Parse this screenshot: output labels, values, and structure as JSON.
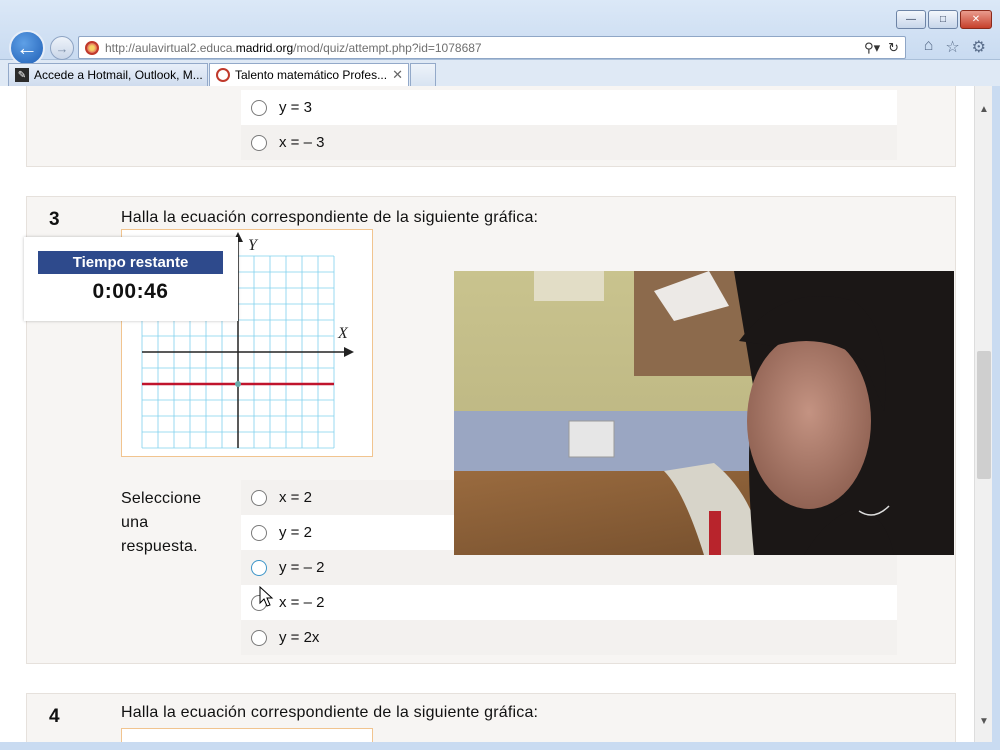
{
  "browser": {
    "url_prefix": "http://aulavirtual2.educa.",
    "url_domain": "madrid.org",
    "url_path": "/mod/quiz/attempt.php?id=1078687",
    "tabs": [
      {
        "label": "Accede a Hotmail, Outlook, M..."
      },
      {
        "label": "Talento matemático Profes..."
      }
    ]
  },
  "quiz": {
    "q2": {
      "options": [
        "y = 3",
        "x = – 3"
      ]
    },
    "q3": {
      "number": "3",
      "text": "Halla la ecuación correspondiente de la siguiente gráfica:",
      "select_label": "Seleccione una respuesta.",
      "graph_axis_x": "X",
      "graph_axis_y": "Y",
      "graph_line_value": -2,
      "options": [
        "x = 2",
        "y = 2",
        "y = – 2",
        "x = – 2",
        "y = 2x"
      ]
    },
    "q4": {
      "number": "4",
      "text": "Halla la ecuación correspondiente de la siguiente gráfica:"
    }
  },
  "timer": {
    "title": "Tiempo restante",
    "value": "0:00:46"
  },
  "colors": {
    "timer_header": "#2e4a8c",
    "graph_line": "#c0142c",
    "grid": "#7fd0ee",
    "graph_border": "#f1c48f"
  }
}
